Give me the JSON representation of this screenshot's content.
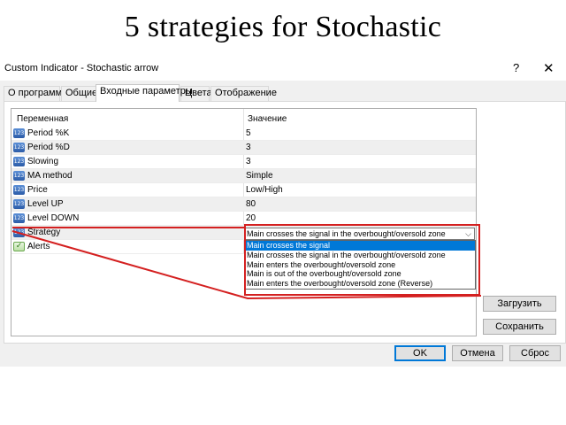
{
  "banner": {
    "text": "5 strategies for Stochastic"
  },
  "window": {
    "title": "Custom Indicator - Stochastic arrow",
    "help_glyph": "?",
    "close_glyph": "✕"
  },
  "tabs": [
    {
      "label": "О программе",
      "active": false
    },
    {
      "label": "Общие",
      "active": false
    },
    {
      "label": "Входные параметры",
      "active": true
    },
    {
      "label": "Цвета",
      "active": false
    },
    {
      "label": "Отображение",
      "active": false
    }
  ],
  "grid": {
    "col_variable": "Переменная",
    "col_value": "Значение",
    "rows": [
      {
        "name": "Period %K",
        "value": "5",
        "icon": "number-icon"
      },
      {
        "name": "Period %D",
        "value": "3",
        "icon": "number-icon"
      },
      {
        "name": "Slowing",
        "value": "3",
        "icon": "number-icon"
      },
      {
        "name": "MA method",
        "value": "Simple",
        "icon": "number-icon"
      },
      {
        "name": "Price",
        "value": "Low/High",
        "icon": "number-icon"
      },
      {
        "name": "Level UP",
        "value": "80",
        "icon": "number-icon"
      },
      {
        "name": "Level DOWN",
        "value": "20",
        "icon": "number-icon"
      },
      {
        "name": "Strategy",
        "value": "Main crosses the signal in the overbought/oversold zone",
        "icon": "number-icon"
      },
      {
        "name": "Alerts",
        "value": "",
        "icon": "alert-icon"
      }
    ]
  },
  "icon_glyph": "123",
  "strategy_dropdown": {
    "selected": "Main crosses the signal in the overbought/oversold zone",
    "arrow": "⌵",
    "options": [
      "Main crosses the signal",
      "Main crosses the signal in the overbought/oversold zone",
      "Main enters the overbought/oversold zone",
      "Main is out of the overbought/oversold zone",
      "Main enters the overbought/oversold zone (Reverse)"
    ],
    "highlighted_index": 0
  },
  "buttons": {
    "load": "Загрузить",
    "save": "Сохранить",
    "ok": "OK",
    "cancel": "Отмена",
    "reset": "Сброс"
  },
  "colors": {
    "highlight": "#0078d7",
    "annotation": "#d42020"
  }
}
